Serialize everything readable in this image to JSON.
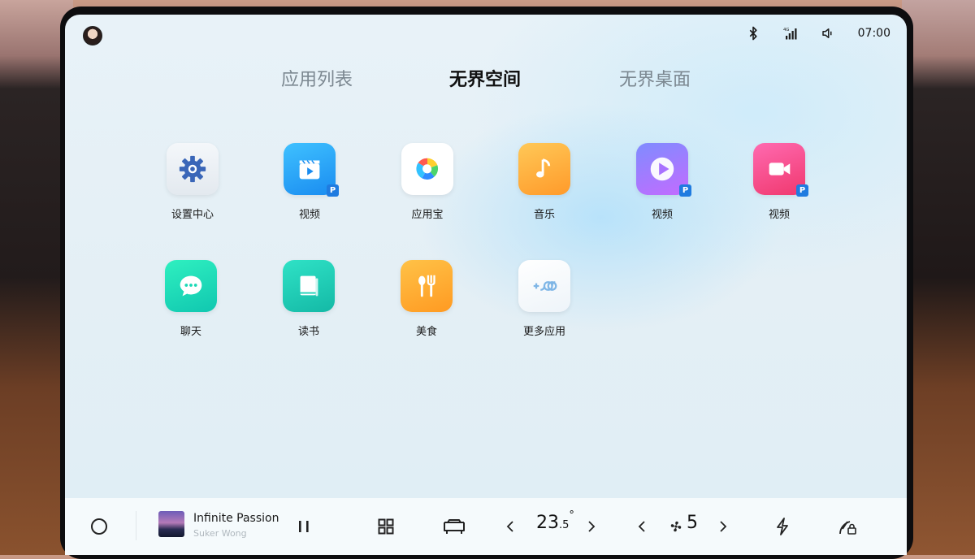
{
  "status": {
    "time": "07:00",
    "icons": [
      "bluetooth-icon",
      "signal-4g-icon",
      "volume-icon"
    ]
  },
  "tabs": [
    {
      "label": "应用列表",
      "active": false
    },
    {
      "label": "无界空间",
      "active": true
    },
    {
      "label": "无界桌面",
      "active": false
    }
  ],
  "apps": [
    {
      "label": "设置中心",
      "icon": "settings-gear-icon",
      "color": "#eef2f6"
    },
    {
      "label": "视频",
      "icon": "video-clapper-icon",
      "color": "#1fa3ff",
      "badge": "P"
    },
    {
      "label": "应用宝",
      "icon": "app-store-icon",
      "color": "#ffffff"
    },
    {
      "label": "音乐",
      "icon": "music-note-icon",
      "color": "#ffb43a"
    },
    {
      "label": "视频",
      "icon": "video-play-icon",
      "color": "#a972ff",
      "badge": "P"
    },
    {
      "label": "视频",
      "icon": "video-camera-icon",
      "color": "#ff4fa0",
      "badge": "P"
    },
    {
      "label": "聊天",
      "icon": "chat-bubble-icon",
      "color": "#19d9b6"
    },
    {
      "label": "读书",
      "icon": "book-icon",
      "color": "#1ed1b8"
    },
    {
      "label": "美食",
      "icon": "food-icon",
      "color": "#ffac2e"
    },
    {
      "label": "更多应用",
      "icon": "more-apps-icon",
      "color": "#f4f8fb"
    }
  ],
  "dock": {
    "song_title": "Infinite Passion",
    "song_artist": "Suker Wong",
    "temperature_main": "23",
    "temperature_decimal": ".5",
    "temperature_unit": "°",
    "fan_level": "5"
  }
}
